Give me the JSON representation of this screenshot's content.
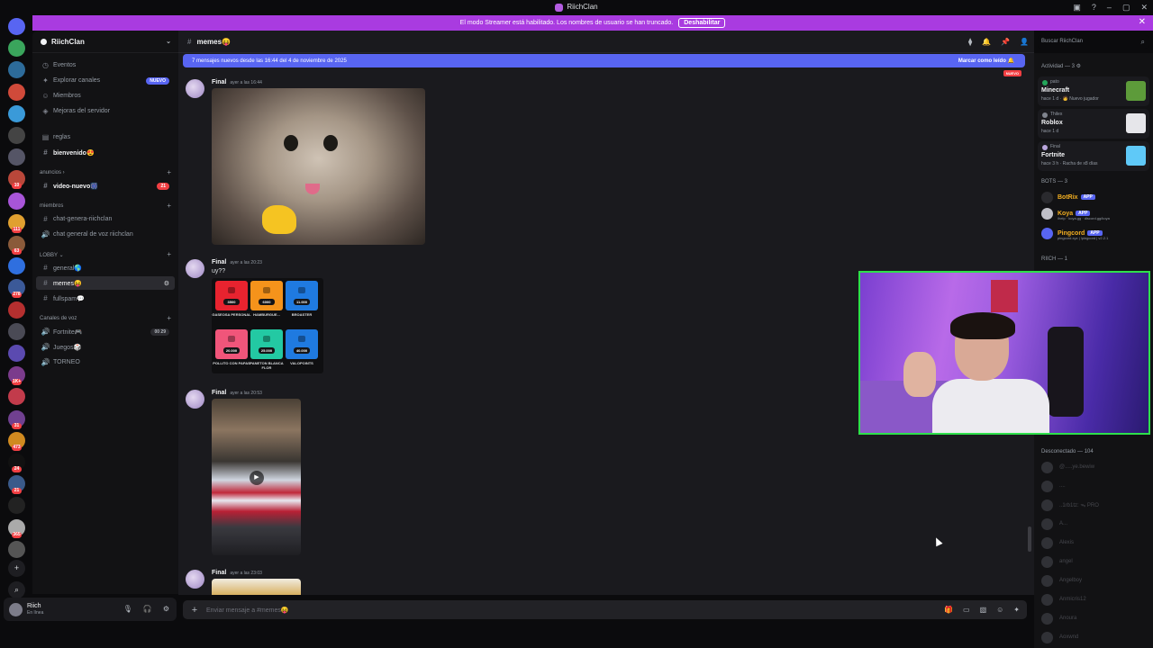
{
  "window": {
    "title": "RiichClan",
    "controls": [
      "▣",
      "?",
      "–",
      "▢",
      "✕"
    ]
  },
  "banner": {
    "text": "El modo Streamer está habilitado. Los nombres de usuario se han truncado.",
    "button": "Deshabilitar",
    "close": "✕"
  },
  "servers": {
    "badges": [
      "",
      "",
      "",
      "",
      "",
      "",
      "",
      "10",
      "",
      "111",
      "63",
      "",
      "278",
      "",
      "",
      "",
      "1K+",
      "",
      "31",
      "473",
      "24",
      "21",
      "",
      "365",
      "",
      "507",
      "260"
    ],
    "colors": [
      "#5865f2",
      "#3aa55c",
      "#2d6b9a",
      "#d04a3a",
      "#3a9ad9",
      "#444",
      "#556",
      "#b9473a",
      "#a855d8",
      "#e0a030",
      "#8a5a3a",
      "#2f6fdf",
      "#3b5998",
      "#b52f2f",
      "#4a4a55",
      "#5b4ab0",
      "#7b3b8c",
      "#c23b4b",
      "#704090",
      "#d08a20",
      "#111",
      "#3a5a8a",
      "#222",
      "#aaa",
      "#555",
      "#c03030",
      "#333"
    ]
  },
  "guild": {
    "name": "RiichClan"
  },
  "channels": {
    "top": [
      {
        "icon": "◷",
        "label": "Eventos"
      },
      {
        "icon": "✦",
        "label": "Explorar canales",
        "badge": "NUEVO"
      },
      {
        "icon": "☺",
        "label": "Miembros"
      },
      {
        "icon": "◈",
        "label": "Mejoras del servidor"
      }
    ],
    "list": [
      {
        "icon": "▤",
        "label": "reglas",
        "style": ""
      },
      {
        "icon": "#",
        "label": "bienvenido😍",
        "style": "bold"
      },
      {
        "icon": "#",
        "label": "video-nuevo🎆",
        "style": "bold",
        "badge": "21"
      },
      {
        "icon": "#",
        "label": "chat-genera-riichclan",
        "style": ""
      },
      {
        "icon": "🔊",
        "label": "chat general de voz riichclan",
        "style": ""
      },
      {
        "icon": "#",
        "label": "general🌎",
        "style": ""
      },
      {
        "icon": "#",
        "label": "memes😝",
        "style": "active"
      },
      {
        "icon": "#",
        "label": "fullspam💬",
        "style": ""
      },
      {
        "icon": "🔊",
        "label": "Fortnite🎮",
        "style": "",
        "badge": "00 29"
      },
      {
        "icon": "🔊",
        "label": "Juegos🎲",
        "style": ""
      },
      {
        "icon": "🔊",
        "label": "TORNEO",
        "style": ""
      }
    ],
    "categories": [
      "anuncios ›",
      "miembros",
      "LOBBY ⌄",
      "Canales de voz"
    ]
  },
  "user": {
    "name": "Riich",
    "status": "En línea",
    "controls": [
      "🎙",
      "🎧",
      "⚙"
    ]
  },
  "header": {
    "channel": "memes😝",
    "icons": [
      "⧫",
      "🔔",
      "📌",
      "👤"
    ],
    "search_placeholder": "Buscar RiichClan"
  },
  "newbar": {
    "text": "7 mensajes nuevos desde las 16:44 del 4 de noviembre de 2025",
    "mark": "Marcar como leído 🔔",
    "tag": "NUEVO"
  },
  "messages": [
    {
      "author": "Final",
      "time": "ayer a las 16:44",
      "text": ""
    },
    {
      "author": "Final",
      "time": "ayer a las 20:23",
      "text": "uy??"
    },
    {
      "author": "Final",
      "time": "ayer a las 20:53",
      "text": ""
    },
    {
      "author": "Final",
      "time": "ayer a las 23:03",
      "text": ""
    }
  ],
  "shop": [
    {
      "price": "3500",
      "label": "GASEOSA PERSONAL",
      "color": "#e8232f"
    },
    {
      "price": "6000",
      "label": "HAMBURGUE...",
      "color": "#f5931b"
    },
    {
      "price": "11.000",
      "label": "BROASTER",
      "color": "#1f7ae0"
    },
    {
      "price": "20.000",
      "label": "POLLITO CON PAPAS",
      "color": "#f0557a"
    },
    {
      "price": "25.000",
      "label": "PANETON BLANCA FLOR",
      "color": "#23c9a3"
    },
    {
      "price": "40.000",
      "label": "VALOPOINTS",
      "color": "#1f7ae0"
    }
  ],
  "composer": {
    "placeholder": "Enviar mensaje a #memes😝",
    "plus": "+",
    "icons": [
      "🎁",
      "▭",
      "▧",
      "☺",
      "✦"
    ]
  },
  "members": {
    "activity_title": "Actividad — 3 ⚙",
    "activities": [
      {
        "user": "pato",
        "game": "Minecraft",
        "meta": "hace 1 d · 🧑 Nuevo jugador",
        "dot": "#23a55a",
        "img": "#5d9b3a"
      },
      {
        "user": "Thilex",
        "game": "Roblox",
        "meta": "hace 1 d",
        "dot": "#80848e",
        "img": "#e6e6ea"
      },
      {
        "user": "Final",
        "game": "Fortnite",
        "meta": "hace 3 h · Racha de x8 días",
        "dot": "#b9a6dc",
        "img": "#5fc9f8"
      }
    ],
    "bots_title": "BOTS — 3",
    "bots": [
      {
        "name": "BotRix",
        "sub": "",
        "color": "#f5b021",
        "av": "#2a2a2e"
      },
      {
        "name": "Koya",
        "sub": "/help · koya.gg · discord.gg/koya",
        "color": "#f5b021",
        "av": "#c0c0c8"
      },
      {
        "name": "Pingcord",
        "sub": "pingcord.xyz | !pingcord | v2.2.1",
        "color": "#f5b021",
        "av": "#5865f2"
      }
    ],
    "riich_title": "RIICH — 1",
    "offline_title": "Desconectado — 104",
    "offline": [
      "@.....ye.bewiw",
      "....",
      "..1rb1tz: ᯓ PRO",
      "A...",
      "Alexis",
      "angel",
      "Angelboy",
      "Anmicris12",
      "Anoura",
      "Aoxwnd"
    ],
    "app": "APP"
  }
}
